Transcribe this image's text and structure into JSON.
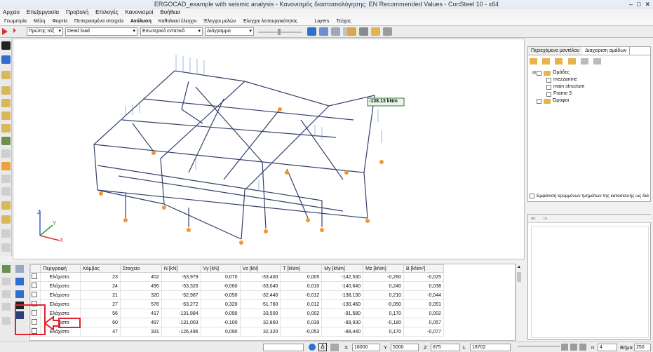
{
  "window": {
    "title": "ERGOCAD_example with seismic analysis - Κανονισμός διαστασιολόγησης: EN Recommended Values - ConSteel 10 - x64"
  },
  "menu": [
    "Αρχείο",
    "Επεξεργασία",
    "Προβολή",
    "Επιλογές",
    "Κανονισμοί",
    "Βοήθεια"
  ],
  "ribbon_tabs": [
    "Γεωμετρία",
    "Μέλη",
    "Φορτία",
    "Πεπερασμένα στοιχεία",
    "Ανάλυση",
    "Καθολικοί έλεγχοι",
    "Έλεγχοι μελών",
    "Έλεγχοι λειτουργικότητας",
    "Layers",
    "Τεύχος"
  ],
  "ribbon_active": "Ανάλυση",
  "toolbar": {
    "analysis_order": "Πρώτης τάξ",
    "load_case": "Dead load",
    "result_type": "Εσωτερικά εντατικά",
    "display_mode": "Διάγραμμα"
  },
  "viewport": {
    "tooltip_value": "-138.13 kNm",
    "axes": {
      "z": "Z",
      "y": "Y",
      "x": "X"
    }
  },
  "right_panel": {
    "tabs": [
      "Περιεχόμενο μοντέλου",
      "Διαχείριση ομάδων"
    ],
    "tree": [
      {
        "label": "Ομάδες",
        "level": 0,
        "kind": "folder"
      },
      {
        "label": "mezzanine",
        "level": 1,
        "kind": "item"
      },
      {
        "label": "main structure",
        "level": 1,
        "kind": "item"
      },
      {
        "label": "Frame 3",
        "level": 1,
        "kind": "item"
      },
      {
        "label": "Όροφοι",
        "level": 0,
        "kind": "folder"
      }
    ],
    "footer": "Εμφάνιση κρυμμένων τμημάτων της κατασκευής ως διά"
  },
  "table": {
    "headers": [
      "",
      "Περιγραφή",
      "Κόμβος",
      "Στοιχείο",
      "N [kN]",
      "Vy [kN]",
      "Vz [kN]",
      "T [kNm]",
      "My [kNm]",
      "Mz [kNm]",
      "B [kNm²]"
    ],
    "rows": [
      [
        "Ελάχιστο",
        "23",
        "402",
        "-53,979",
        "0,070",
        "-33,400",
        "0,005",
        "-142,530",
        "-0,260",
        "-0,025"
      ],
      [
        "Ελάχιστο",
        "24",
        "496",
        "-53,326",
        "-0,060",
        "-33,040",
        "0,010",
        "-140,640",
        "0,240",
        "0,038"
      ],
      [
        "Ελάχιστο",
        "21",
        "320",
        "-52,987",
        "-0,050",
        "-32,440",
        "-0,012",
        "-138,130",
        "0,210",
        "-0,044"
      ],
      [
        "Ελάχιστο",
        "27",
        "576",
        "-53,272",
        "0,320",
        "-51,760",
        "0,012",
        "-130,460",
        "-0,050",
        "0,051"
      ],
      [
        "Ελάχιστο",
        "56",
        "417",
        "-131,884",
        "0,090",
        "33,500",
        "0,002",
        "-91,580",
        "0,170",
        "0,002"
      ],
      [
        "Ελάχιστο",
        "60",
        "497",
        "-131,003",
        "-0,100",
        "32,860",
        "0,039",
        "-89,930",
        "-0,180",
        "0,057"
      ],
      [
        "Ελάχιστο",
        "47",
        "331",
        "-126,496",
        "0,090",
        "32,320",
        "-0,053",
        "-88,440",
        "0,170",
        "-0,077"
      ]
    ]
  },
  "status": {
    "x_label": "X",
    "x_value": "18000",
    "y_label": "Y",
    "y_value": "5000",
    "z_label": "Z",
    "z_value": "875",
    "l_label": "L",
    "l_value": "18702",
    "n_label": "n",
    "n_value": "4",
    "step_label": "Βήμα",
    "step_value": "250"
  },
  "colors": {
    "support": "#f2962e",
    "member": "#35406a",
    "load": "#8fa6cf",
    "highlight": "#e0242f",
    "tooltip_border": "#2e7d32"
  }
}
